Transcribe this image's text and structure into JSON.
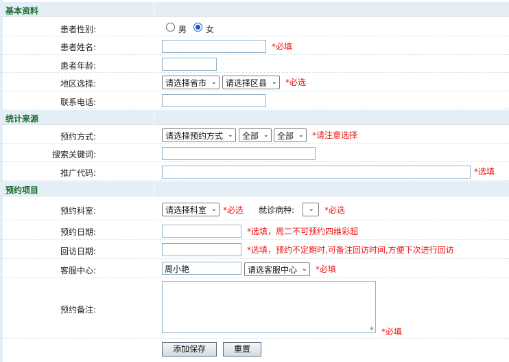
{
  "sections": {
    "basic": "基本资料",
    "source": "统计来源",
    "appointment": "预约项目"
  },
  "basic": {
    "gender_label": "患者性别:",
    "gender_options": [
      "男",
      "女"
    ],
    "gender_selected": "女",
    "name_label": "患者姓名:",
    "name_required": "*必填",
    "age_label": "患者年龄:",
    "region_label": "地区选择:",
    "region_province": "请选择省市",
    "region_county": "请选择区县",
    "region_required": "*必选",
    "phone_label": "联系电话:"
  },
  "source": {
    "method_label": "预约方式:",
    "method_select": "请选择预约方式",
    "method_sub1": "全部",
    "method_sub2": "全部",
    "method_note": "*请注意选择",
    "keyword_label": "搜索关键词:",
    "promo_label": "推广代码:",
    "promo_note": "*选填"
  },
  "appointment": {
    "dept_label": "预约科室:",
    "dept_select": "请选择科室",
    "dept_required": "*必选",
    "disease_label": "就诊病种:",
    "disease_select": "",
    "disease_required": "*必选",
    "date_label": "预约日期:",
    "date_note": "*选填，周二不可预约四维彩超",
    "revisit_label": "回访日期:",
    "revisit_note": "*选填，预约不定期时,可备注回访时间,方便下次进行回访",
    "service_label": "客服中心:",
    "service_value": "周小艳",
    "service_select": "请选客服中心",
    "service_required": "*必填",
    "remark_label": "预约备注:",
    "remark_required": "*必填"
  },
  "buttons": {
    "save": "添加保存",
    "reset": "重置"
  },
  "colors": {
    "section_bg": "#e4eef6",
    "section_title": "#1a6b2a",
    "required": "#ee1111",
    "radio_checked": "#1a56c4"
  }
}
